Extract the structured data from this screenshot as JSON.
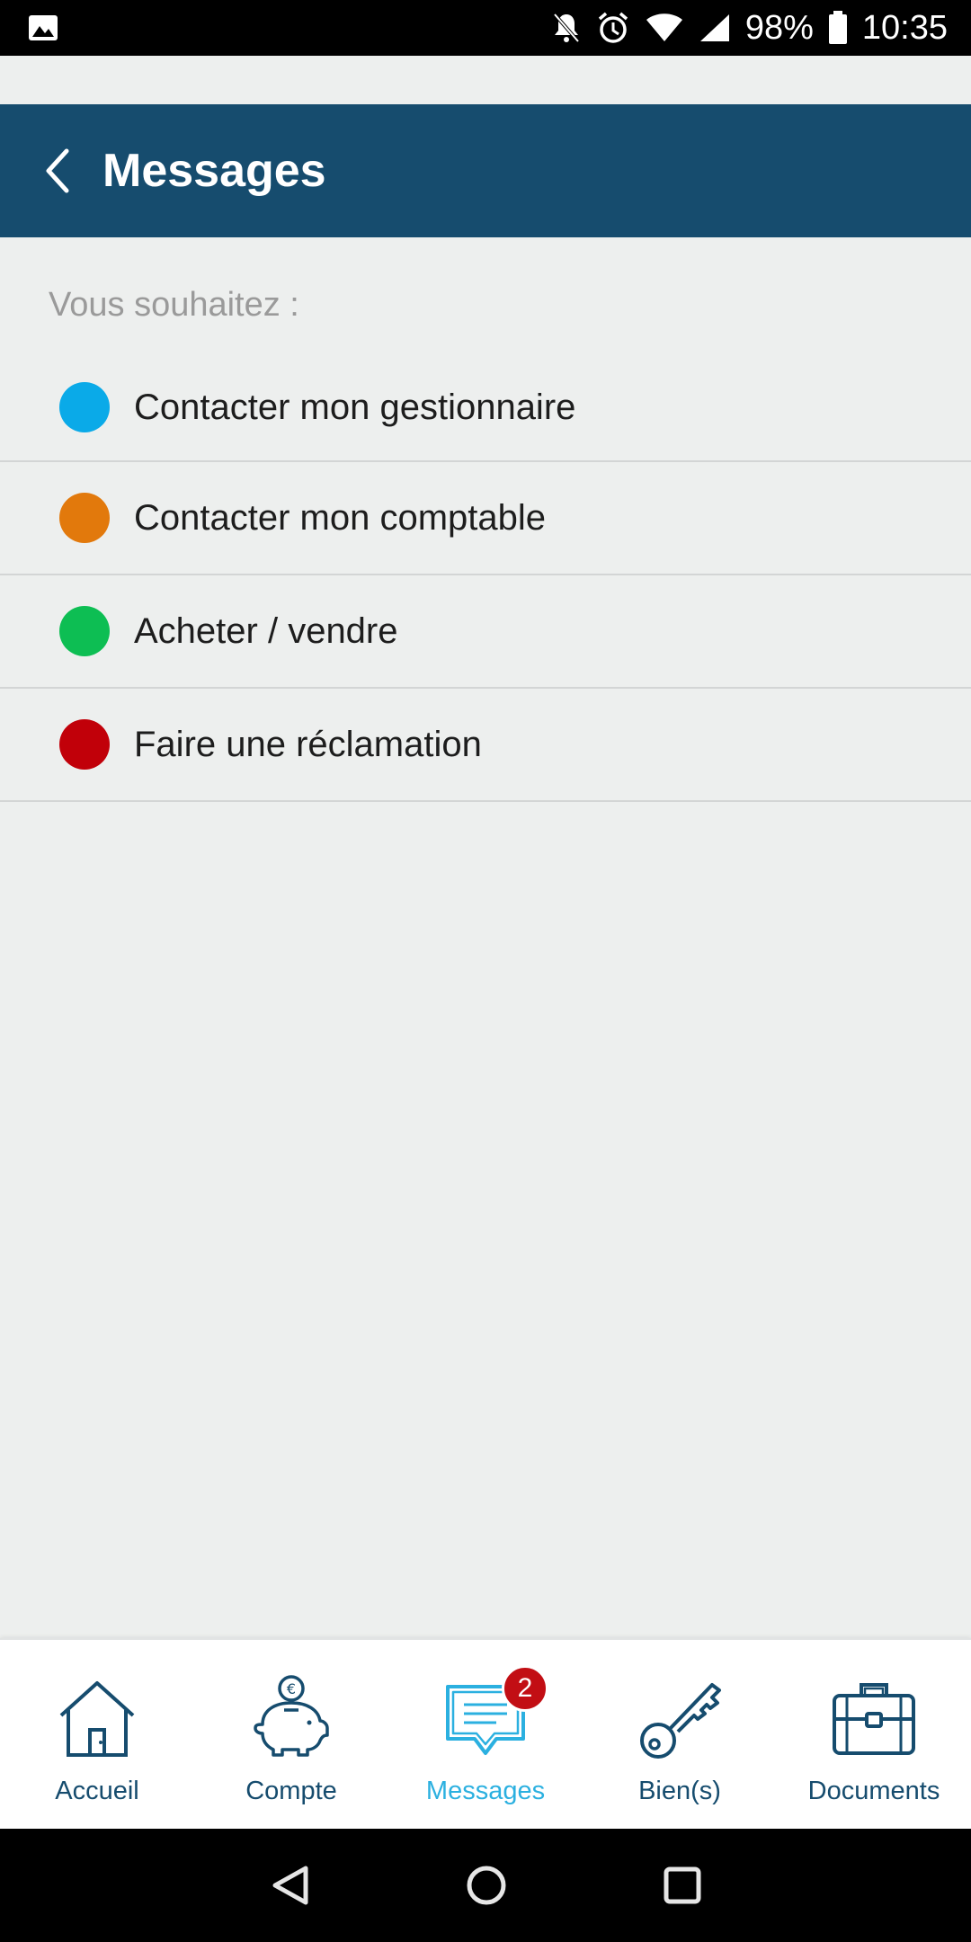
{
  "status_bar": {
    "battery": "98%",
    "time": "10:35"
  },
  "app_bar": {
    "title": "Messages"
  },
  "content": {
    "prompt": "Vous souhaitez :",
    "options": [
      {
        "label": "Contacter mon gestionnaire",
        "color": "#0aaae8"
      },
      {
        "label": "Contacter mon comptable",
        "color": "#e2790c"
      },
      {
        "label": "Acheter / vendre",
        "color": "#0dbe53"
      },
      {
        "label": "Faire une réclamation",
        "color": "#c10009"
      }
    ]
  },
  "bottom_nav": {
    "items": [
      {
        "label": "Accueil",
        "icon": "house-icon"
      },
      {
        "label": "Compte",
        "icon": "piggy-bank-icon"
      },
      {
        "label": "Messages",
        "icon": "chat-icon",
        "badge": "2",
        "active": true
      },
      {
        "label": "Bien(s)",
        "icon": "key-icon"
      },
      {
        "label": "Documents",
        "icon": "briefcase-icon"
      }
    ]
  },
  "colors": {
    "primary": "#164c6e",
    "active": "#2bb0e0",
    "badge": "#c20e14"
  }
}
